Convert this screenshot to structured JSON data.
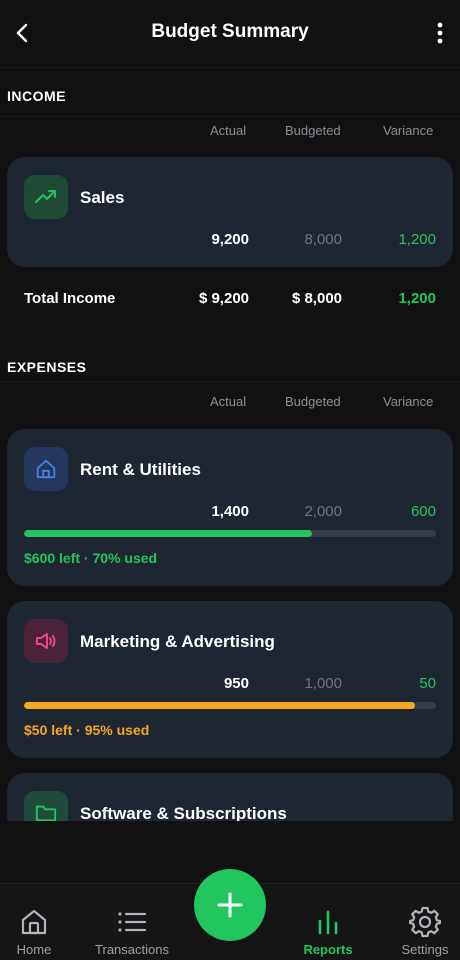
{
  "header": {
    "title": "Budget Summary"
  },
  "columns": {
    "actual": "Actual",
    "budgeted": "Budgeted",
    "variance": "Variance"
  },
  "income": {
    "section_title": "INCOME",
    "items": [
      {
        "name": "Sales",
        "actual": "9,200",
        "budgeted": "8,000",
        "variance": "1,200",
        "icon": "trending-up-icon"
      }
    ],
    "total": {
      "label": "Total Income",
      "actual": "$ 9,200",
      "budgeted": "$ 8,000",
      "variance": "1,200"
    }
  },
  "expenses": {
    "section_title": "EXPENSES",
    "items": [
      {
        "name": "Rent & Utilities",
        "actual": "1,400",
        "budgeted": "2,000",
        "variance": "600",
        "status": "$600 left · 70% used",
        "progress": 0.7,
        "color": "#22c55e",
        "icon": "home-icon"
      },
      {
        "name": "Marketing & Advertising",
        "actual": "950",
        "budgeted": "1,000",
        "variance": "50",
        "status": "$50 left · 95% used",
        "progress": 0.95,
        "color": "#f5a623",
        "icon": "megaphone-icon"
      },
      {
        "name": "Software & Subscriptions",
        "icon": "folder-icon"
      }
    ]
  },
  "nav": {
    "items": [
      {
        "label": "Home",
        "icon": "home-icon"
      },
      {
        "label": "Transactions",
        "icon": "list-icon"
      },
      {
        "label": "Reports",
        "icon": "bar-chart-icon",
        "active": true
      },
      {
        "label": "Settings",
        "icon": "gear-icon"
      }
    ],
    "fab_icon": "plus-icon"
  },
  "colors": {
    "accent": "#22c55e",
    "warning": "#f5a623",
    "card": "#1e2632",
    "background": "#111111"
  }
}
